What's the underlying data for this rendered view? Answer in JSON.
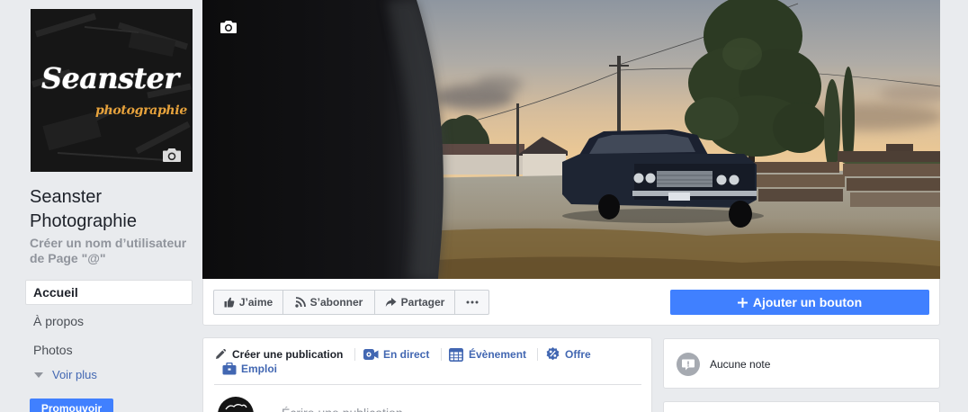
{
  "profile": {
    "logo_main": "Seanster",
    "logo_sub": "photographie"
  },
  "page": {
    "name": "Seanster Photographie",
    "username_prompt": "Créer un nom d’utilisateur de Page \"@\""
  },
  "nav": {
    "items": [
      {
        "label": "Accueil",
        "active": true
      },
      {
        "label": "À propos",
        "active": false
      },
      {
        "label": "Photos",
        "active": false
      }
    ],
    "see_more": "Voir plus",
    "promote": "Promouvoir"
  },
  "actions": {
    "like": "J’aime",
    "follow": "S’abonner",
    "share": "Partager",
    "add_button": "Ajouter un bouton"
  },
  "composer": {
    "create_post": "Créer une publication",
    "live": "En direct",
    "event": "Évènement",
    "offer": "Offre",
    "job": "Emploi",
    "placeholder": "Écrire une publication"
  },
  "sidebar_right": {
    "notes_empty": "Aucune note"
  },
  "icons": {
    "cover_edit": "camera-icon",
    "profile_edit": "camera-icon",
    "like": "thumbs-up-icon",
    "follow": "rss-icon",
    "share": "share-arrow-icon",
    "more": "more-dots-icon",
    "add_button": "plus-icon",
    "create_post": "pencil-icon",
    "live": "live-video-icon",
    "event": "calendar-icon",
    "offer": "offer-percent-icon",
    "job": "briefcase-icon",
    "notes": "note-bubble-icon",
    "see_more": "chevron-down-icon"
  },
  "colors": {
    "page_background": "#e9ebee",
    "link_blue": "#4267b2",
    "button_blue": "#4080ff",
    "muted_text": "#90949c",
    "logo_accent": "#e6a23c"
  }
}
